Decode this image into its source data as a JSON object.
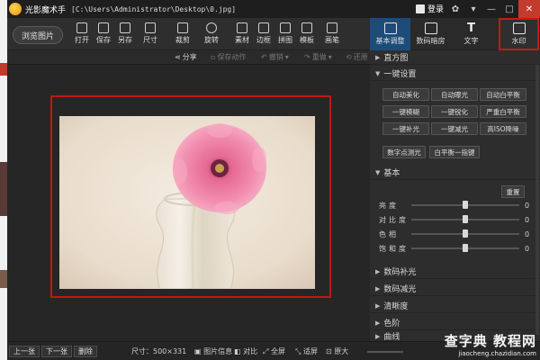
{
  "title": {
    "app_name": "光影魔术手",
    "path": "[C:\\Users\\Administrator\\Desktop\\0.jpg]",
    "login": "登录"
  },
  "toolbar": {
    "browse": "浏览图片",
    "tools": [
      {
        "icon": "open-icon",
        "label": "打开"
      },
      {
        "icon": "save-icon",
        "label": "保存"
      },
      {
        "icon": "save-as-icon",
        "label": "另存"
      },
      {
        "icon": "size-icon",
        "label": "尺寸"
      },
      {
        "icon": "crop-icon",
        "label": "裁剪"
      },
      {
        "icon": "rotate-icon",
        "label": "旋转"
      },
      {
        "icon": "material-icon",
        "label": "素材"
      },
      {
        "icon": "border-icon",
        "label": "边框"
      },
      {
        "icon": "collage-icon",
        "label": "拼图"
      },
      {
        "icon": "template-icon",
        "label": "模板"
      },
      {
        "icon": "paint-icon",
        "label": "画笔"
      }
    ]
  },
  "tabs": [
    {
      "icon": "basic-adjust-icon",
      "label": "基本调整"
    },
    {
      "icon": "darkroom-icon",
      "label": "数码暗房"
    },
    {
      "icon": "text-icon",
      "label": "文字"
    },
    {
      "icon": "watermark-icon",
      "label": "水印"
    }
  ],
  "subbar": {
    "share": "分享",
    "save_action": "保存动作",
    "undo": "撤销",
    "redo": "重做",
    "restore": "还原"
  },
  "panel": {
    "histogram": "直方图",
    "one_click": "一键设置",
    "one_click_buttons": [
      "自动美化",
      "自动曝光",
      "自动白平衡",
      "一键模糊",
      "一键锐化",
      "严重白平衡",
      "一键补光",
      "一键减光",
      "高ISO降噪",
      "数字点测光",
      "白平衡一指键"
    ],
    "basic": "基本",
    "reset": "重置",
    "sliders": [
      {
        "label": "亮度",
        "value": "0",
        "level": 0.5
      },
      {
        "label": "对比度",
        "value": "0",
        "level": 0.5
      },
      {
        "label": "色相",
        "value": "0",
        "level": 0.5
      },
      {
        "label": "饱和度",
        "value": "0",
        "level": 0.5
      }
    ],
    "sections": [
      "数码补光",
      "数码减光",
      "清晰度",
      "色阶",
      "曲线"
    ]
  },
  "status": {
    "prev": "上一张",
    "next": "下一张",
    "delete": "删除",
    "size": "尺寸：500×331",
    "info": "图片信息",
    "compare": "对比",
    "fullscreen": "全屏",
    "fit": "适屏",
    "original": "原大"
  },
  "site": {
    "name": "查字典",
    "suffix": "教程网",
    "url": "jiaocheng.chazidian.com"
  },
  "colors": {
    "accent_red": "#c41a12",
    "active_tab": "#1d4c7a"
  }
}
